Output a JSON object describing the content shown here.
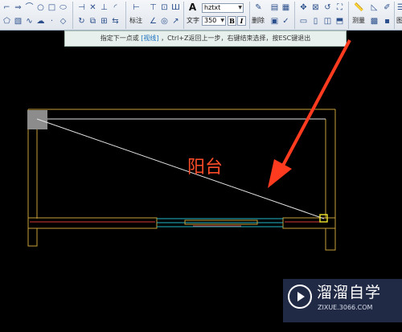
{
  "toolbar": {
    "dim_label": "标注",
    "text_label": "文字",
    "font_name": "hztxt",
    "font_size": "350",
    "bold": "B",
    "italic": "I",
    "delete_label": "删除",
    "measure_label": "测量",
    "truncated_label": "图"
  },
  "prompt": {
    "before": "指定下一点或",
    "link": "[视线]",
    "after": "，Ctrl+Z返回上一步，右键结束选择，按ESC键退出"
  },
  "drawing": {
    "room_label": "阳台",
    "colors": {
      "wall": "#c8a03a",
      "measure_line": "#e6e6e6",
      "red_line": "#ff3b1f",
      "window": "#22b8c8",
      "snap": "#f0e62a",
      "room_text": "#ff4d2a"
    }
  },
  "watermark": {
    "title": "溜溜自学",
    "url": "ZIXUE.3066.COM"
  }
}
